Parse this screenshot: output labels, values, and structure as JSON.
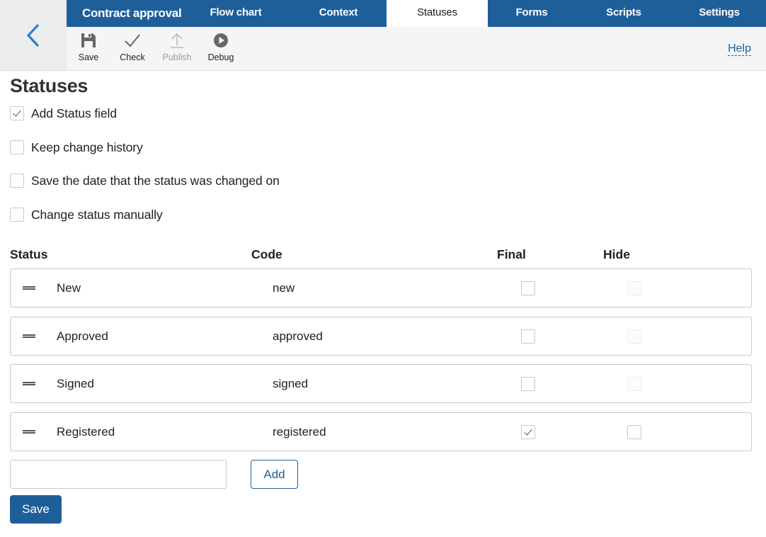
{
  "app": {
    "title": "Contract approval"
  },
  "tabs": [
    {
      "label": "Flow chart",
      "active": false
    },
    {
      "label": "Context",
      "active": false
    },
    {
      "label": "Statuses",
      "active": true
    },
    {
      "label": "Forms",
      "active": false
    },
    {
      "label": "Scripts",
      "active": false
    },
    {
      "label": "Settings",
      "active": false
    }
  ],
  "toolbar": {
    "save": {
      "label": "Save",
      "icon": "floppy-disk-icon"
    },
    "check": {
      "label": "Check",
      "icon": "checkmark-icon"
    },
    "publish": {
      "label": "Publish",
      "icon": "upload-icon",
      "disabled": true
    },
    "debug": {
      "label": "Debug",
      "icon": "play-circle-icon"
    },
    "help": "Help"
  },
  "page": {
    "title": "Statuses"
  },
  "options": [
    {
      "label": "Add Status field",
      "checked": true
    },
    {
      "label": "Keep change history",
      "checked": false
    },
    {
      "label": "Save the date that the status was changed on",
      "checked": false
    },
    {
      "label": "Change status manually",
      "checked": false
    }
  ],
  "table": {
    "headers": {
      "status": "Status",
      "code": "Code",
      "final": "Final",
      "hide": "Hide"
    },
    "rows": [
      {
        "name": "New",
        "code": "new",
        "final": false,
        "hide": false,
        "hide_disabled": true
      },
      {
        "name": "Approved",
        "code": "approved",
        "final": false,
        "hide": false,
        "hide_disabled": true
      },
      {
        "name": "Signed",
        "code": "signed",
        "final": false,
        "hide": false,
        "hide_disabled": true
      },
      {
        "name": "Registered",
        "code": "registered",
        "final": true,
        "hide": false,
        "hide_disabled": false
      }
    ]
  },
  "new_status": {
    "value": "",
    "placeholder": ""
  },
  "buttons": {
    "add": "Add",
    "save": "Save"
  },
  "colors": {
    "brand": "#1f5f99",
    "back_arrow": "#2a7fd4",
    "toolbar_bg": "#f5f5f5"
  }
}
